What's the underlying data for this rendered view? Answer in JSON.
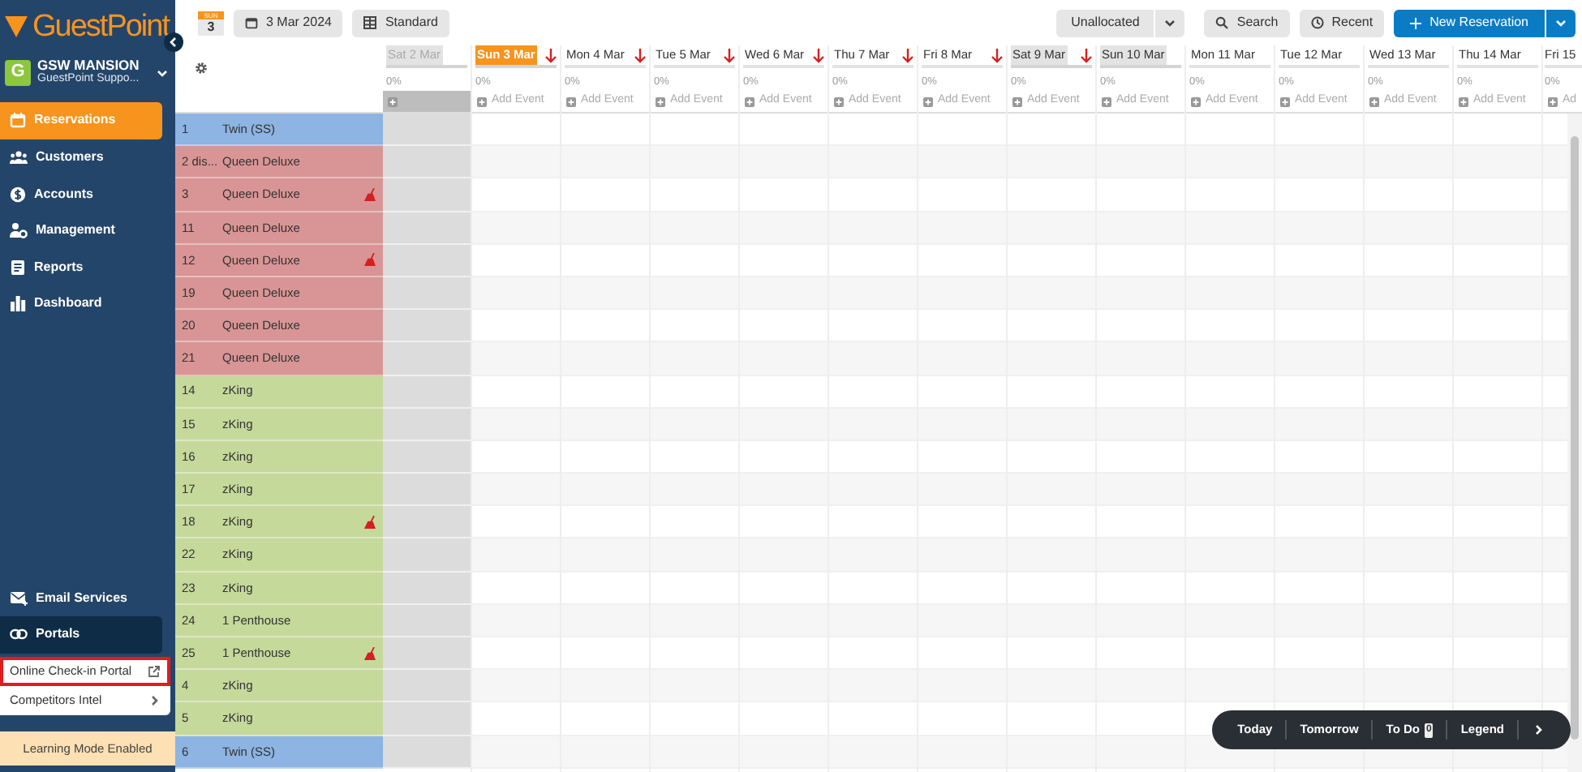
{
  "sidebar": {
    "logo": "GuestPoint",
    "account": {
      "initial": "G",
      "name": "GSW MANSION",
      "subtitle": "GuestPoint Suppo..."
    },
    "nav": [
      {
        "label": "Reservations",
        "selected": true
      },
      {
        "label": "Customers",
        "selected": false
      },
      {
        "label": "Accounts",
        "selected": false
      },
      {
        "label": "Management",
        "selected": false
      },
      {
        "label": "Reports",
        "selected": false
      },
      {
        "label": "Dashboard",
        "selected": false
      }
    ],
    "lower_nav": [
      {
        "label": "Email Services",
        "selected": false
      },
      {
        "label": "Portals",
        "selected": true
      }
    ],
    "submenu": [
      {
        "label": "Online Check-in Portal",
        "kind": "external",
        "highlighted": true
      },
      {
        "label": "Competitors Intel",
        "kind": "submenu",
        "highlighted": false
      }
    ],
    "footer": "Learning Mode Enabled"
  },
  "toolbar": {
    "day_badge": {
      "weekday": "SUN",
      "day": "3"
    },
    "date_button": "3 Mar 2024",
    "view_button": "Standard",
    "unallocated": "Unallocated",
    "search": "Search",
    "recent": "Recent",
    "new_reservation": "New Reservation"
  },
  "calendar": {
    "columns": [
      {
        "label": "Sat 2 Mar",
        "occupancy": "0%",
        "past": true,
        "today": false,
        "weekend": true,
        "arrow": false
      },
      {
        "label": "Sun 3 Mar",
        "occupancy": "0%",
        "add_event": "Add Event",
        "past": false,
        "today": true,
        "weekend": true,
        "arrow": true
      },
      {
        "label": "Mon 4 Mar",
        "occupancy": "0%",
        "add_event": "Add Event",
        "past": false,
        "today": false,
        "weekend": false,
        "arrow": true
      },
      {
        "label": "Tue 5 Mar",
        "occupancy": "0%",
        "add_event": "Add Event",
        "past": false,
        "today": false,
        "weekend": false,
        "arrow": true
      },
      {
        "label": "Wed 6 Mar",
        "occupancy": "0%",
        "add_event": "Add Event",
        "past": false,
        "today": false,
        "weekend": false,
        "arrow": true
      },
      {
        "label": "Thu 7 Mar",
        "occupancy": "0%",
        "add_event": "Add Event",
        "past": false,
        "today": false,
        "weekend": false,
        "arrow": true
      },
      {
        "label": "Fri 8 Mar",
        "occupancy": "0%",
        "add_event": "Add Event",
        "past": false,
        "today": false,
        "weekend": false,
        "arrow": true
      },
      {
        "label": "Sat 9 Mar",
        "occupancy": "0%",
        "add_event": "Add Event",
        "past": false,
        "today": false,
        "weekend": true,
        "arrow": true
      },
      {
        "label": "Sun 10 Mar",
        "occupancy": "0%",
        "add_event": "Add Event",
        "past": false,
        "today": false,
        "weekend": true,
        "arrow": false
      },
      {
        "label": "Mon 11 Mar",
        "occupancy": "0%",
        "add_event": "Add Event",
        "past": false,
        "today": false,
        "weekend": false,
        "arrow": false
      },
      {
        "label": "Tue 12 Mar",
        "occupancy": "0%",
        "add_event": "Add Event",
        "past": false,
        "today": false,
        "weekend": false,
        "arrow": false
      },
      {
        "label": "Wed 13 Mar",
        "occupancy": "0%",
        "add_event": "Add Event",
        "past": false,
        "today": false,
        "weekend": false,
        "arrow": false
      },
      {
        "label": "Thu 14 Mar",
        "occupancy": "0%",
        "add_event": "Add Event",
        "past": false,
        "today": false,
        "weekend": false,
        "arrow": false
      },
      {
        "label": "Fri 15",
        "occupancy": "0%",
        "add_event": "Ad",
        "past": false,
        "today": false,
        "weekend": false,
        "arrow": false
      }
    ],
    "rooms": [
      {
        "number": "1",
        "type": "Twin (SS)",
        "color": "#8db4e2",
        "flagged": false
      },
      {
        "number": "2 dis...",
        "type": "Queen Deluxe",
        "color": "#d99595",
        "flagged": false
      },
      {
        "number": "3",
        "type": "Queen Deluxe",
        "color": "#d99595",
        "flagged": true
      },
      {
        "number": "11",
        "type": "Queen Deluxe",
        "color": "#d99595",
        "flagged": false
      },
      {
        "number": "12",
        "type": "Queen Deluxe",
        "color": "#d99595",
        "flagged": true
      },
      {
        "number": "19",
        "type": "Queen Deluxe",
        "color": "#d99595",
        "flagged": false
      },
      {
        "number": "20",
        "type": "Queen Deluxe",
        "color": "#d99595",
        "flagged": false
      },
      {
        "number": "21",
        "type": "Queen Deluxe",
        "color": "#d99595",
        "flagged": false
      },
      {
        "number": "14",
        "type": "zKing",
        "color": "#c5d99b",
        "flagged": false
      },
      {
        "number": "15",
        "type": "zKing",
        "color": "#c5d99b",
        "flagged": false
      },
      {
        "number": "16",
        "type": "zKing",
        "color": "#c5d99b",
        "flagged": false
      },
      {
        "number": "17",
        "type": "zKing",
        "color": "#c5d99b",
        "flagged": false
      },
      {
        "number": "18",
        "type": "zKing",
        "color": "#c5d99b",
        "flagged": true
      },
      {
        "number": "22",
        "type": "zKing",
        "color": "#c5d99b",
        "flagged": false
      },
      {
        "number": "23",
        "type": "zKing",
        "color": "#c5d99b",
        "flagged": false
      },
      {
        "number": "24",
        "type": "1 Penthouse",
        "color": "#c5d99b",
        "flagged": false
      },
      {
        "number": "25",
        "type": "1 Penthouse",
        "color": "#c5d99b",
        "flagged": true
      },
      {
        "number": "4",
        "type": "zKing",
        "color": "#c5d99b",
        "flagged": false
      },
      {
        "number": "5",
        "type": "zKing",
        "color": "#c5d99b",
        "flagged": false
      },
      {
        "number": "6",
        "type": "Twin (SS)",
        "color": "#8db4e2",
        "flagged": false
      }
    ]
  },
  "bottom_bar": {
    "items": [
      "Today",
      "Tomorrow",
      "To Do",
      "Legend"
    ],
    "todo_count": "0"
  }
}
